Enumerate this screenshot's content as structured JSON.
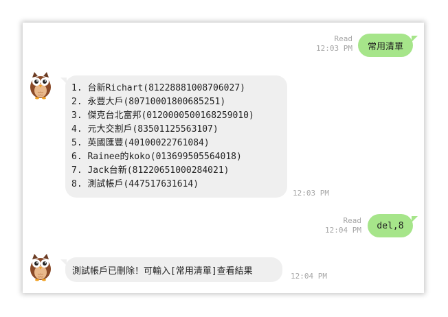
{
  "messages": [
    {
      "from": "me",
      "status": "Read",
      "time": "12:03 PM",
      "text": "常用清單"
    },
    {
      "from": "bot",
      "time": "12:03 PM",
      "lines": [
        "1. 台新Richart(812288810087060​27)",
        "2. 永豐大戶(807100018006852​51)",
        "3. 傑克台北富邦(0120000500168259010)",
        "4. 元大交割戶(83501125563107)",
        "5. 英國匯豐(40100022761084)",
        "6. Rainee的koko(013699505564018)",
        "7. Jack台新(81220651000284021)",
        "8. 測試帳戶(447517631614)"
      ]
    },
    {
      "from": "me",
      "status": "Read",
      "time": "12:04 PM",
      "text": "del,8"
    },
    {
      "from": "bot",
      "time": "12:04 PM",
      "text": "測試帳戶已刪除！可輸入[常用清單]查看結果"
    }
  ],
  "icons": {
    "avatar": "owl-avatar-icon"
  },
  "colors": {
    "outgoing_bubble": "#a6e58a",
    "incoming_bubble": "#efefef",
    "meta_text": "#a6a6a6"
  }
}
